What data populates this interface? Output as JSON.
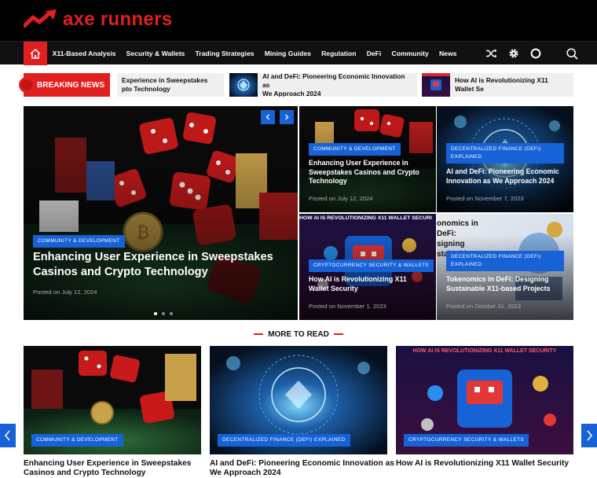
{
  "brand": {
    "name": "axe runners",
    "accent": "#e11f1f",
    "blue": "#1662d6"
  },
  "nav": {
    "items": [
      "X11-Based Analysis",
      "Security & Wallets",
      "Trading Strategies",
      "Mining Guides",
      "Regulation",
      "DeFi",
      "Community",
      "News"
    ],
    "icons": [
      "home-icon",
      "shuffle-icon",
      "gear-icon",
      "dark-mode-icon",
      "search-icon"
    ]
  },
  "breaking": {
    "label": "BREAKING NEWS",
    "items": [
      "Experience in Sweepstakes\npto Technology",
      "AI and DeFi: Pioneering Economic Innovation as\nWe Approach 2024",
      "How AI is Revolutionizing X11 Wallet Se"
    ]
  },
  "hero": {
    "category": "COMMUNITY & DEVELOPMENT",
    "title": "Enhancing User Experience in Sweepstakes Casinos and Crypto Technology",
    "date": "Posted on July 12, 2024"
  },
  "tiles": [
    {
      "category": "COMMUNITY & DEVELOPMENT",
      "title": "Enhancing User Experience in Sweepstakes Casinos and Crypto Technology",
      "date": "Posted on July 12, 2024"
    },
    {
      "category": "DECENTRALIZED FINANCE (DEFI) EXPLAINED",
      "title": "AI and DeFi: Pioneering Economic Innovation as We Approach 2024",
      "date": "Posted on November 7, 2023"
    },
    {
      "category": "CRYPTOCURRENCY SECURITY & WALLETS",
      "title": "How AI is Revolutionizing X11 Wallet Security",
      "date": "Posted on November 1, 2023",
      "banner": "HOW AI IS REVOLUTIONIZING X11 WALLET SECURI"
    },
    {
      "category": "DECENTRALIZED FINANCE (DEFI) EXPLAINED",
      "title": "Tokenomics in DeFi: Designing Sustainable X11-based Projects",
      "date": "Posted on October 31, 2023",
      "banner": "onomics in DeFi:\nsigning\nstainable"
    }
  ],
  "more": {
    "heading": "MORE TO READ",
    "cards": [
      {
        "category": "COMMUNITY & DEVELOPMENT",
        "title": "Enhancing User Experience in Sweepstakes Casinos and Crypto Technology"
      },
      {
        "category": "DECENTRALIZED FINANCE (DEFI) EXPLAINED",
        "title": "AI and DeFi: Pioneering Economic Innovation as We Approach 2024"
      },
      {
        "category": "CRYPTOCURRENCY SECURITY & WALLETS",
        "title": "How AI is Revolutionizing X11 Wallet Security",
        "banner": "HOW AI IS REVOLUTIONIZING X11 WALLET SECURITY"
      }
    ]
  }
}
